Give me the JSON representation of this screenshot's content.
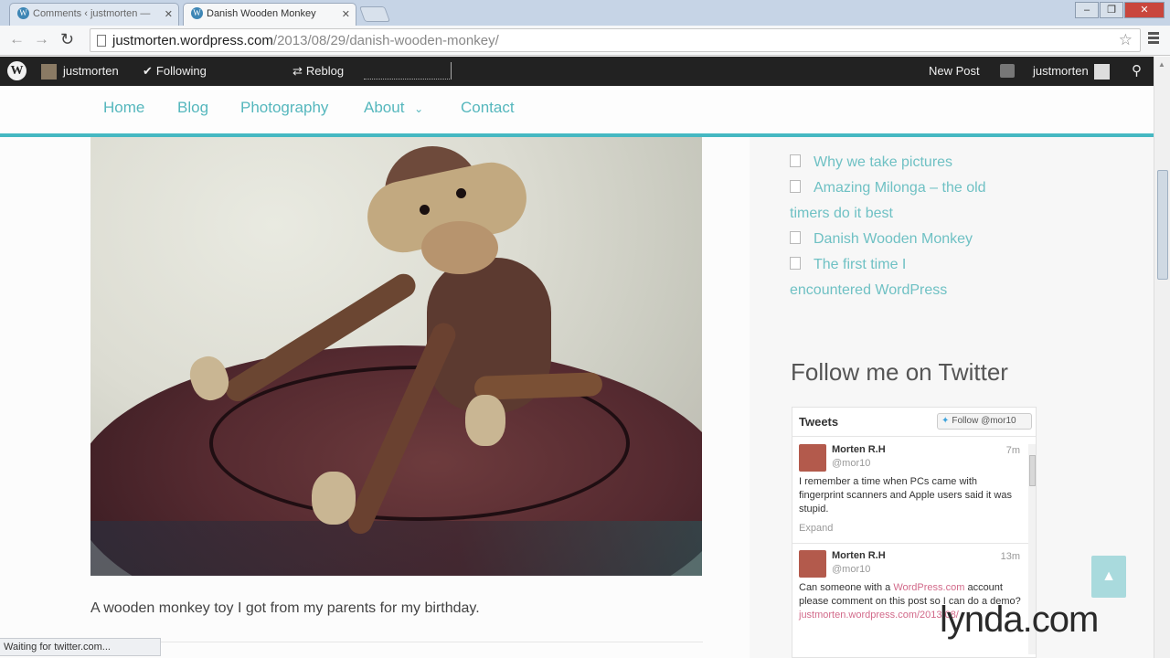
{
  "browser": {
    "tabs": [
      {
        "title": "Comments ‹ justmorten —",
        "active": false
      },
      {
        "title": "Danish Wooden Monkey",
        "active": true
      }
    ],
    "url_host": "justmorten.wordpress.com",
    "url_path": "/2013/08/29/danish-wooden-monkey/",
    "status_text": "Waiting for twitter.com..."
  },
  "adminbar": {
    "site": "justmorten",
    "following": "Following",
    "reblog": "Reblog",
    "new_post": "New Post",
    "user": "justmorten"
  },
  "nav": {
    "items": [
      "Home",
      "Blog",
      "Photography",
      "About",
      "Contact"
    ]
  },
  "post": {
    "caption": "A wooden monkey toy I got from my parents for my birthday."
  },
  "sidebar": {
    "recent_posts": [
      "Why we take pictures",
      "Amazing Milonga – the old timers do it best",
      "Danish Wooden Monkey",
      "The first time I encountered WordPress"
    ],
    "twitter_title": "Follow me on Twitter"
  },
  "twitter": {
    "header": "Tweets",
    "follow_label": "Follow @mor10",
    "tweets": [
      {
        "name": "Morten R.H",
        "handle": "@mor10",
        "time": "7m",
        "text": "I remember a time when PCs came with fingerprint scanners and Apple users said it was stupid.",
        "expand": "Expand"
      },
      {
        "name": "Morten R.H",
        "handle": "@mor10",
        "time": "13m",
        "text_before": "Can someone with a ",
        "link": "WordPress.com",
        "text_after": " account please comment on this post so I can do a demo?",
        "link2": "justmorten.wordpress.com/2013/08/"
      }
    ]
  },
  "watermark": "lynda.com",
  "colors": {
    "accent": "#45b8c2",
    "link": "#6fc1c4",
    "adminbar": "#222222"
  }
}
